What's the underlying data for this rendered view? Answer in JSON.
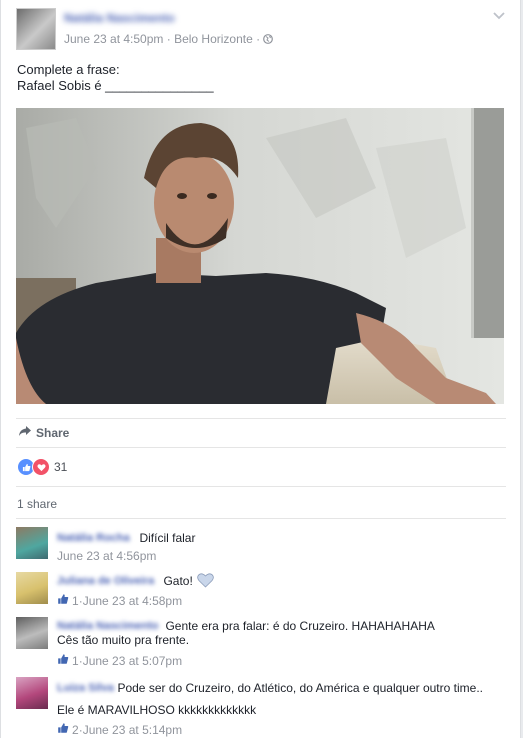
{
  "post": {
    "author_name": "Natália Nascimento",
    "date": "June 23 at 4:50pm",
    "location": "Belo Horizonte",
    "text_line1": "Complete a frase:",
    "text_line2": "Rafael Sobis é _______________"
  },
  "actions": {
    "share_label": "Share"
  },
  "reactions": {
    "count": "31"
  },
  "shares": {
    "label": "1 share"
  },
  "comments": [
    {
      "author": "Natália Rocha",
      "text": "Difícil falar",
      "text2": "",
      "time": "June 23 at 4:56pm",
      "likes": ""
    },
    {
      "author": "Juliana de Oliveira",
      "text": "Gato!",
      "text2": "",
      "time": "June 23 at 4:58pm",
      "likes": "1"
    },
    {
      "author": "Natália Nascimento",
      "text": "Gente era pra falar: é do Cruzeiro. HAHAHAHAHA",
      "text2": "Cês tão muito pra frente.",
      "time": "June 23 at 5:07pm",
      "likes": "1"
    },
    {
      "author": "Luiza Silva",
      "text": "Pode ser do Cruzeiro, do Atlético, do América e qualquer outro time..",
      "text2": "Ele é MARAVILHOSO kkkkkkkkkkkkk",
      "time": "June 23 at 5:14pm",
      "likes": "2"
    }
  ],
  "separator": " · ",
  "icons": {
    "globe": "globe-icon",
    "share": "share-arrow-icon",
    "like": "like-icon",
    "love": "love-icon"
  },
  "colors": {
    "link": "#4b63b5",
    "muted": "#90949c",
    "like": "#5890ff",
    "love": "#f25268"
  }
}
